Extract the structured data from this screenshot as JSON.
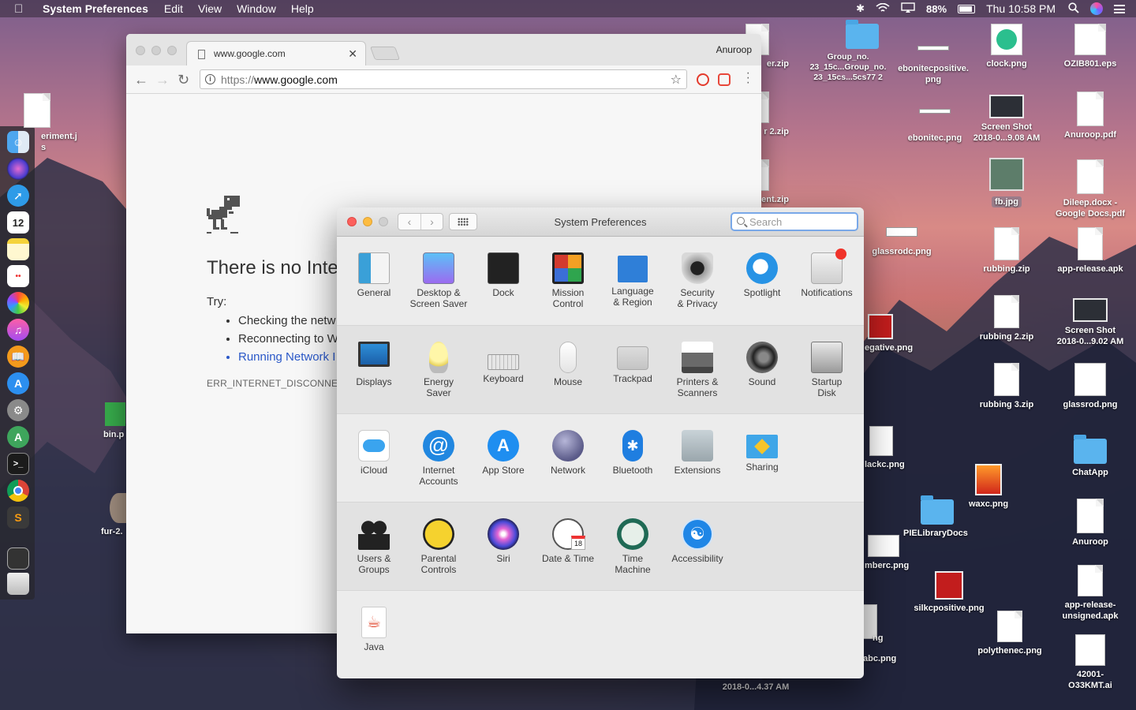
{
  "menubar": {
    "app_name": "System Preferences",
    "menus": [
      "Edit",
      "View",
      "Window",
      "Help"
    ],
    "battery": "88%",
    "clock": "Thu 10:58 PM"
  },
  "desktop_items": [
    {
      "label": "eriment.j\ns",
      "kind": "doc"
    },
    {
      "label": "bin.p",
      "kind": "thumb"
    },
    {
      "label": "fur-2.",
      "kind": "thumb"
    },
    {
      "label": "er.zip",
      "kind": "doc"
    },
    {
      "label": "r 2.zip",
      "kind": "doc"
    },
    {
      "label": "ent.zip",
      "kind": "doc"
    },
    {
      "label": "Group_no.\n23_15c...Group_no.\n23_15cs...5cs77 2",
      "kind": "folder"
    },
    {
      "label": "ebonitecpositive.\npng",
      "kind": "doc"
    },
    {
      "label": "ebonitec.png",
      "kind": "doc"
    },
    {
      "label": "clock.png",
      "kind": "thumb"
    },
    {
      "label": "OZIB801.eps",
      "kind": "doc"
    },
    {
      "label": "Screen Shot\n2018-0...9.08 AM",
      "kind": "thumb"
    },
    {
      "label": "Anuroop.pdf",
      "kind": "doc"
    },
    {
      "label": "fb.jpg",
      "kind": "thumb"
    },
    {
      "label": "Dileep.docx -\nGoogle Docs.pdf",
      "kind": "doc"
    },
    {
      "label": "glassrodc.png",
      "kind": "doc"
    },
    {
      "label": "rubbing.zip",
      "kind": "doc"
    },
    {
      "label": "app-release.apk",
      "kind": "doc"
    },
    {
      "label": "egative.png",
      "kind": "thumb"
    },
    {
      "label": "rubbing 2.zip",
      "kind": "doc"
    },
    {
      "label": "Screen Shot\n2018-0...9.02 AM",
      "kind": "thumb"
    },
    {
      "label": "rubbing 3.zip",
      "kind": "doc"
    },
    {
      "label": "glassrod.png",
      "kind": "doc"
    },
    {
      "label": "lackc.png",
      "kind": "thumb"
    },
    {
      "label": "ChatApp",
      "kind": "folder"
    },
    {
      "label": "waxc.png",
      "kind": "thumb"
    },
    {
      "label": "PIELibraryDocs",
      "kind": "folder"
    },
    {
      "label": "Anuroop",
      "kind": "doc"
    },
    {
      "label": "mberc.png",
      "kind": "thumb"
    },
    {
      "label": "silkcpositive.png",
      "kind": "thumb"
    },
    {
      "label": "app-release-\nunsigned.apk",
      "kind": "doc"
    },
    {
      "label": "polythenec.png",
      "kind": "doc"
    },
    {
      "label": "42001-\nO33KMT.ai",
      "kind": "doc"
    },
    {
      "label": "Screen Shot\n2018-0...4.37 AM",
      "kind": "thumb"
    },
    {
      "label": "ng",
      "kind": "thumb"
    },
    {
      "label": "abc.png",
      "kind": "thumb"
    }
  ],
  "chrome": {
    "tab_title": "www.google.com",
    "user": "Anuroop",
    "url_scheme": "https://",
    "url_host": "www.google.com",
    "error_title": "There is no Inte",
    "try_label": "Try:",
    "suggestions": [
      "Checking the netw",
      "Reconnecting to W",
      "Running Network I"
    ],
    "error_code": "ERR_INTERNET_DISCONNECT"
  },
  "sysprefs": {
    "title": "System Preferences",
    "search_placeholder": "Search",
    "rows": [
      [
        {
          "label": [
            "General"
          ],
          "icon": "general-icon"
        },
        {
          "label": [
            "Desktop &",
            "Screen Saver"
          ],
          "icon": "desktop-screensaver-icon"
        },
        {
          "label": [
            "Dock"
          ],
          "icon": "dock-icon"
        },
        {
          "label": [
            "Mission",
            "Control"
          ],
          "icon": "mission-control-icon"
        },
        {
          "label": [
            "Language",
            "& Region"
          ],
          "icon": "language-region-icon"
        },
        {
          "label": [
            "Security",
            "& Privacy"
          ],
          "icon": "security-privacy-icon"
        },
        {
          "label": [
            "Spotlight"
          ],
          "icon": "spotlight-icon"
        },
        {
          "label": [
            "Notifications"
          ],
          "icon": "notifications-icon"
        }
      ],
      [
        {
          "label": [
            "Displays"
          ],
          "icon": "displays-icon"
        },
        {
          "label": [
            "Energy",
            "Saver"
          ],
          "icon": "energy-saver-icon"
        },
        {
          "label": [
            "Keyboard"
          ],
          "icon": "keyboard-icon"
        },
        {
          "label": [
            "Mouse"
          ],
          "icon": "mouse-icon"
        },
        {
          "label": [
            "Trackpad"
          ],
          "icon": "trackpad-icon"
        },
        {
          "label": [
            "Printers &",
            "Scanners"
          ],
          "icon": "printers-scanners-icon"
        },
        {
          "label": [
            "Sound"
          ],
          "icon": "sound-icon"
        },
        {
          "label": [
            "Startup",
            "Disk"
          ],
          "icon": "startup-disk-icon"
        }
      ],
      [
        {
          "label": [
            "iCloud"
          ],
          "icon": "icloud-icon"
        },
        {
          "label": [
            "Internet",
            "Accounts"
          ],
          "icon": "internet-accounts-icon"
        },
        {
          "label": [
            "App Store"
          ],
          "icon": "app-store-icon"
        },
        {
          "label": [
            "Network"
          ],
          "icon": "network-icon"
        },
        {
          "label": [
            "Bluetooth"
          ],
          "icon": "bluetooth-icon"
        },
        {
          "label": [
            "Extensions"
          ],
          "icon": "extensions-icon"
        },
        {
          "label": [
            "Sharing"
          ],
          "icon": "sharing-icon"
        }
      ],
      [
        {
          "label": [
            "Users &",
            "Groups"
          ],
          "icon": "users-groups-icon"
        },
        {
          "label": [
            "Parental",
            "Controls"
          ],
          "icon": "parental-controls-icon"
        },
        {
          "label": [
            "Siri"
          ],
          "icon": "siri-icon"
        },
        {
          "label": [
            "Date & Time"
          ],
          "icon": "date-time-icon"
        },
        {
          "label": [
            "Time",
            "Machine"
          ],
          "icon": "time-machine-icon"
        },
        {
          "label": [
            "Accessibility"
          ],
          "icon": "accessibility-icon"
        }
      ],
      [
        {
          "label": [
            "Java"
          ],
          "icon": "java-icon"
        }
      ]
    ]
  },
  "dock_apps": [
    "finder",
    "siri",
    "safari",
    "calendar",
    "notes",
    "reminders",
    "photos",
    "itunes",
    "ibooks",
    "app-store",
    "system-preferences",
    "android-studio",
    "terminal",
    "chrome",
    "sublime-text",
    "screenshot",
    "trash"
  ],
  "colors": {
    "close": "#fc605c",
    "minimize": "#fdbc40",
    "zoom": "#34c84a",
    "link": "#2a58c8",
    "search_focus": "#79a8e8"
  }
}
